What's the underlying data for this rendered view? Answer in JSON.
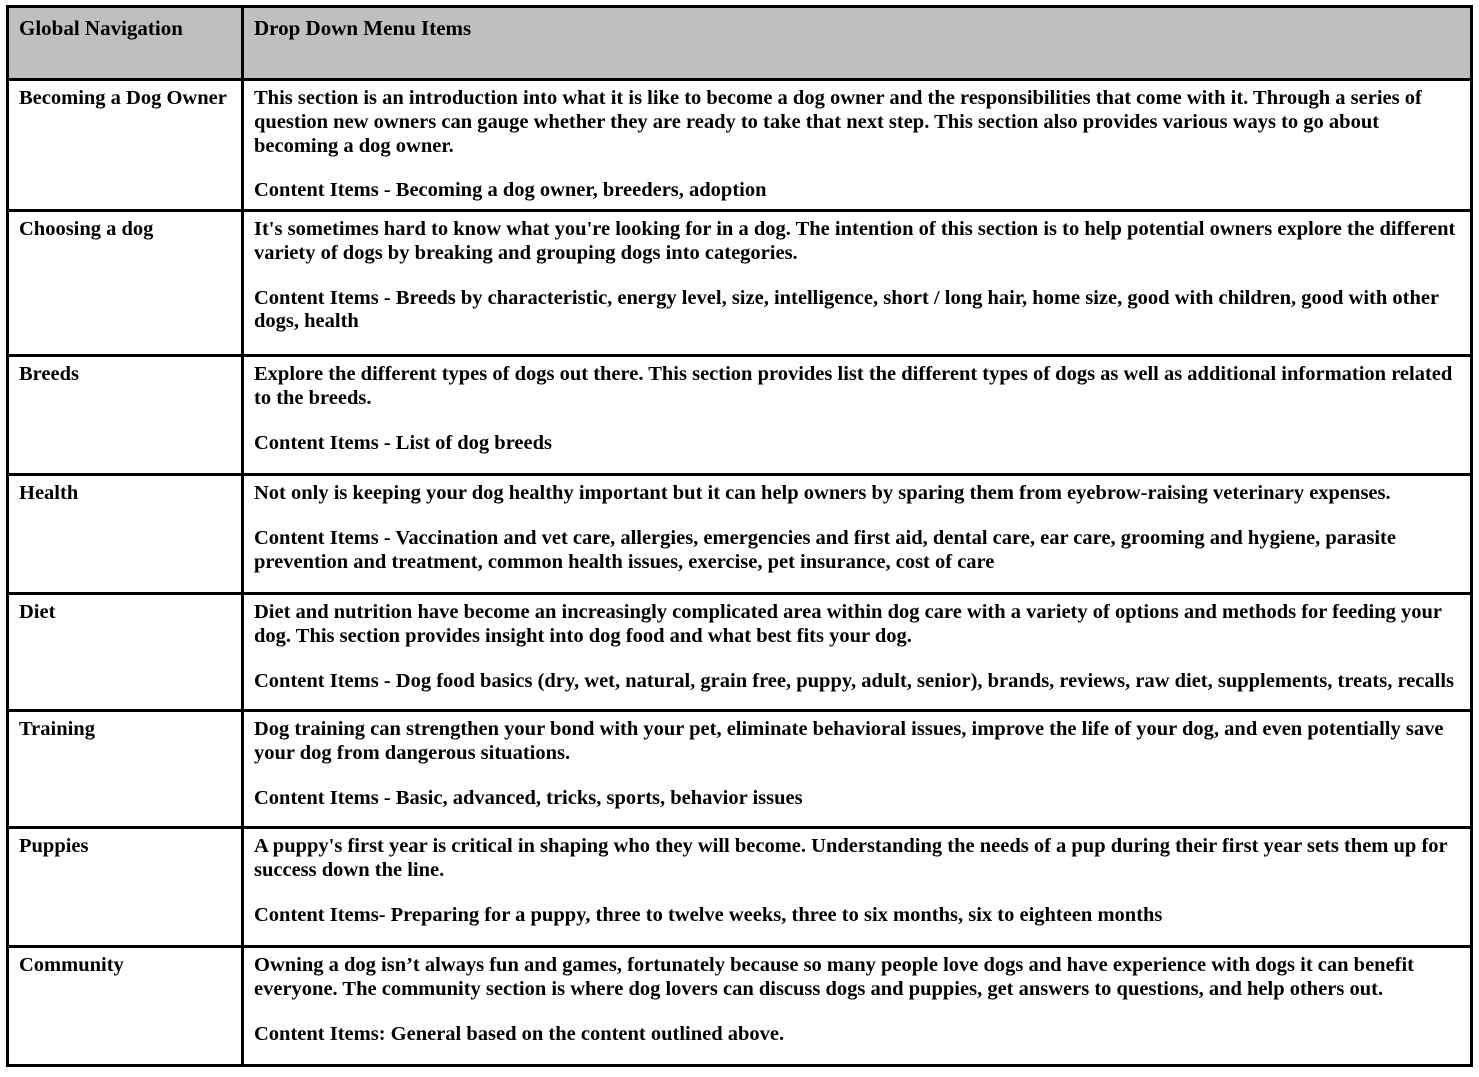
{
  "table": {
    "headers": {
      "navigation": "Global Navigation",
      "menu_items": "Drop Down Menu Items"
    },
    "rows": [
      {
        "nav": "Becoming a Dog Owner",
        "description": "This section is an introduction into what it is like to become a dog owner and the responsibilities that come with it.  Through a series of question new owners can gauge whether they are ready to take that next step.  This section also provides various ways to go about becoming a dog owner.",
        "content_items": "Content Items - Becoming a dog owner, breeders, adoption"
      },
      {
        "nav": "Choosing a dog",
        "description": "It's sometimes hard to know what you're looking for in a dog.  The intention of this section is to help potential owners explore the different variety of dogs by breaking and grouping dogs into categories.",
        "content_items": "Content Items - Breeds by characteristic, energy level, size, intelligence, short / long hair, home size, good with children, good with other dogs, health"
      },
      {
        "nav": "Breeds",
        "description": "Explore the different types of dogs out there.  This section provides list the different types of dogs as well as additional information related to the breeds.",
        "content_items": "Content Items - List of dog breeds"
      },
      {
        "nav": "Health",
        "description": "Not only is keeping your dog healthy important but it can help owners by sparing them from eyebrow-raising veterinary expenses.",
        "content_items": "Content Items - Vaccination and vet care, allergies, emergencies and first aid, dental care, ear care, grooming and hygiene, parasite prevention and treatment, common health issues, exercise, pet insurance, cost of care"
      },
      {
        "nav": "Diet",
        "description": "Diet and nutrition have become an increasingly complicated area within dog care with a variety of options and methods for feeding your dog. This section provides insight into dog food and what best fits your dog.",
        "content_items": "Content Items - Dog food basics (dry, wet, natural, grain free, puppy, adult, senior), brands, reviews, raw diet, supplements, treats, recalls"
      },
      {
        "nav": "Training",
        "description": "Dog training can strengthen your bond with your pet, eliminate behavioral issues, improve the life of your dog, and even potentially save your dog from dangerous situations.",
        "content_items": "Content Items - Basic, advanced, tricks, sports, behavior issues"
      },
      {
        "nav": "Puppies",
        "description": "A puppy's first year is critical in shaping who they will become.  Understanding the needs of a pup during their first year sets them up for success down the line.",
        "content_items": "Content Items- Preparing for a puppy, three to twelve weeks, three to six months, six to eighteen months"
      },
      {
        "nav": "Community",
        "description": "Owning a dog isn’t always fun and games, fortunately because so many people love dogs and have experience with dogs it can benefit everyone. The community section is where dog lovers can discuss dogs and puppies, get answers to questions, and help others out.",
        "content_items": "Content Items: General based on the content outlined above."
      }
    ]
  },
  "colors": {
    "header_background": "#bfbfbf",
    "border": "#000000",
    "text": "#000000",
    "cell_background": "#ffffff"
  }
}
